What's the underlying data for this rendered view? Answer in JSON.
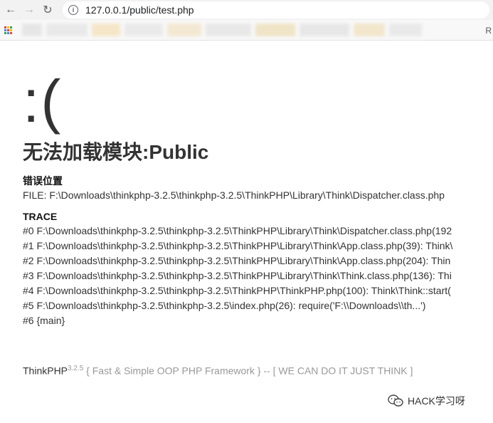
{
  "browser": {
    "back_icon": "back-arrow-icon",
    "forward_icon": "forward-arrow-icon",
    "reload_icon": "reload-icon",
    "url": "127.0.0.1/public/test.php"
  },
  "bookmarks": {
    "trailing_label": "R"
  },
  "page": {
    "face": ":(",
    "error_title": "无法加载模块:Public",
    "location_label": "错误位置",
    "file_line": "FILE: F:\\Downloads\\thinkphp-3.2.5\\thinkphp-3.2.5\\ThinkPHP\\Library\\Think\\Dispatcher.class.php",
    "trace_label": "TRACE",
    "trace": [
      "#0 F:\\Downloads\\thinkphp-3.2.5\\thinkphp-3.2.5\\ThinkPHP\\Library\\Think\\Dispatcher.class.php(192",
      "#1 F:\\Downloads\\thinkphp-3.2.5\\thinkphp-3.2.5\\ThinkPHP\\Library\\Think\\App.class.php(39): Think\\",
      "#2 F:\\Downloads\\thinkphp-3.2.5\\thinkphp-3.2.5\\ThinkPHP\\Library\\Think\\App.class.php(204): Thin",
      "#3 F:\\Downloads\\thinkphp-3.2.5\\thinkphp-3.2.5\\ThinkPHP\\Library\\Think\\Think.class.php(136): Thi",
      "#4 F:\\Downloads\\thinkphp-3.2.5\\thinkphp-3.2.5\\ThinkPHP\\ThinkPHP.php(100): Think\\Think::start(",
      "#5 F:\\Downloads\\thinkphp-3.2.5\\thinkphp-3.2.5\\index.php(26): require('F:\\\\Downloads\\\\th...')",
      "#6 {main}"
    ]
  },
  "footer": {
    "brand": "ThinkPHP",
    "version": "3.2.5",
    "slogan": " { Fast & Simple OOP PHP Framework } -- [ WE CAN DO IT JUST THINK ]"
  },
  "watermark": {
    "text": "HACK学习呀"
  }
}
